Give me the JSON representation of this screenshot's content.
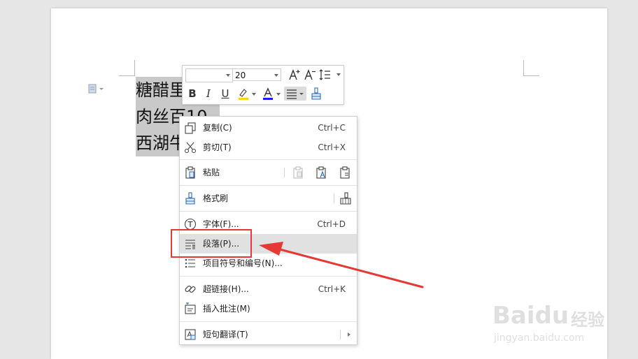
{
  "document": {
    "lines": [
      "糖醋里",
      "肉丝10",
      "西湖牛"
    ],
    "line2_visible": "肉丝百10"
  },
  "mini_toolbar": {
    "font_value": "",
    "size_value": "20",
    "grow_font_icon": "increase-font-size-icon",
    "shrink_font_icon": "decrease-font-size-icon",
    "line_spacing_icon": "line-spacing-icon",
    "bold": "B",
    "italic": "I",
    "underline": "U",
    "highlight_color": "#f5d90a",
    "font_color": "#1a1aff"
  },
  "context_menu": {
    "items": [
      {
        "label": "复制(C)",
        "shortcut": "Ctrl+C",
        "icon": "copy-icon"
      },
      {
        "label": "剪切(T)",
        "shortcut": "Ctrl+X",
        "icon": "cut-icon"
      },
      {
        "label": "粘贴",
        "shortcut": "",
        "icon": "paste-icon"
      },
      {
        "label": "格式刷",
        "shortcut": "",
        "icon": "format-painter-icon"
      },
      {
        "label": "字体(F)...",
        "shortcut": "Ctrl+D",
        "icon": "font-icon"
      },
      {
        "label": "段落(P)...",
        "shortcut": "",
        "icon": "paragraph-icon"
      },
      {
        "label": "项目符号和编号(N)...",
        "shortcut": "",
        "icon": "bullets-icon"
      },
      {
        "label": "超链接(H)...",
        "shortcut": "Ctrl+K",
        "icon": "hyperlink-icon"
      },
      {
        "label": "插入批注(M)",
        "shortcut": "",
        "icon": "comment-icon"
      },
      {
        "label": "短句翻译(T)",
        "shortcut": "",
        "icon": "translate-icon"
      }
    ]
  },
  "annotation": {
    "highlight_color": "#e53935",
    "target_item": "段落(P)..."
  },
  "watermark": {
    "brand": "Baidu",
    "brand_cn": "经验",
    "url": "jingyan.baidu.com"
  }
}
